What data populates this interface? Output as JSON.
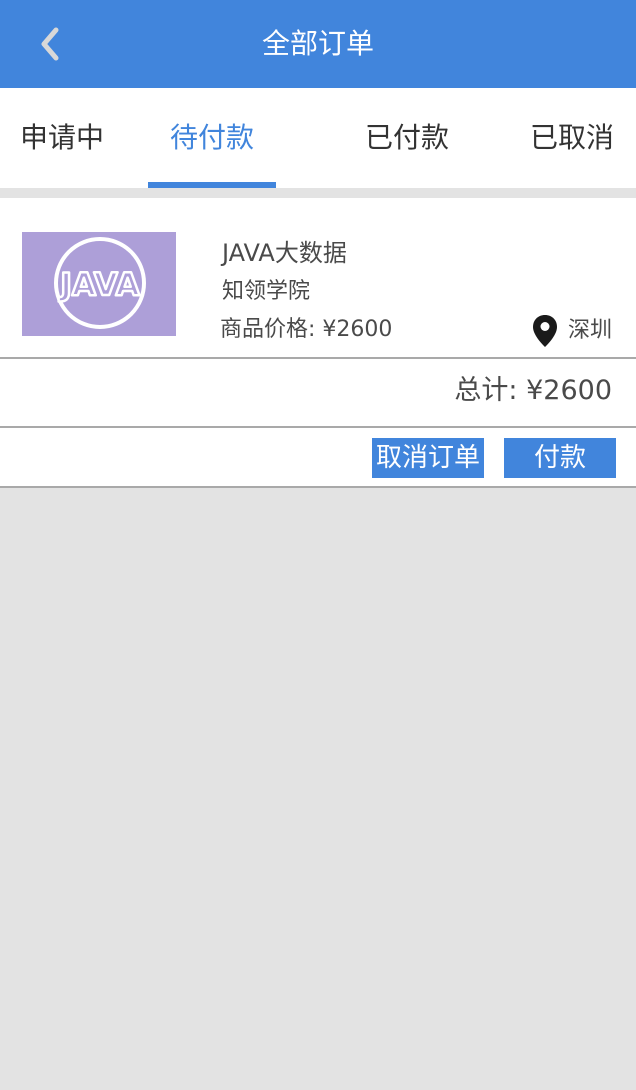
{
  "header": {
    "title": "全部订单",
    "back_icon": "chevron-left-icon"
  },
  "tabs": [
    {
      "label": "申请中",
      "active": false
    },
    {
      "label": "待付款",
      "active": true
    },
    {
      "label": "已付款",
      "active": false
    },
    {
      "label": "已取消",
      "active": false
    }
  ],
  "order": {
    "image_label": "JAVA",
    "product_name": "JAVA大数据",
    "school": "知领学院",
    "price": "商品价格: ¥2600",
    "location_icon": "map-pin-icon",
    "location": "深圳",
    "total": "总计: ¥2600",
    "cancel_label": "取消订单",
    "pay_label": "付款"
  },
  "colors": {
    "primary": "#4185dc",
    "background": "#e3e3e3",
    "thumbnail": "#ad9fd8"
  }
}
